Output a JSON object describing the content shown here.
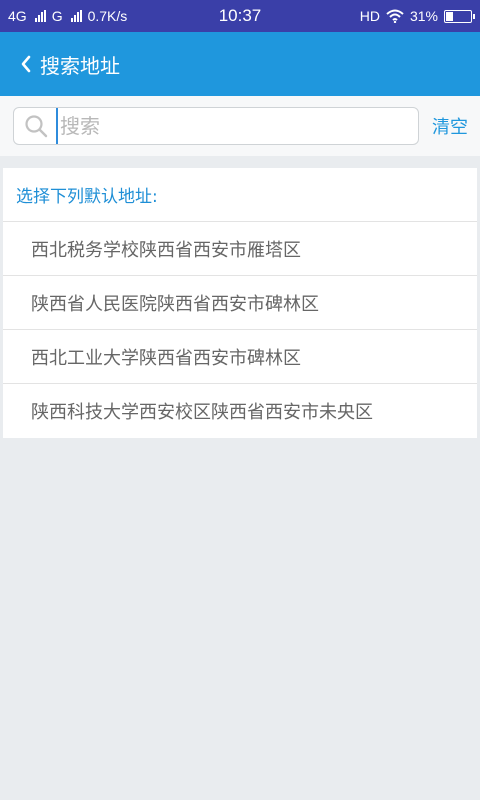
{
  "status_bar": {
    "network1": "4G",
    "network2": "G",
    "speed": "0.7K/s",
    "time": "10:37",
    "hd": "HD",
    "battery": "31%",
    "battery_level": 0.31
  },
  "nav": {
    "title": "搜索地址"
  },
  "search": {
    "placeholder": "搜索",
    "value": "",
    "clear_label": "清空"
  },
  "addresses": {
    "header": "选择下列默认地址:",
    "items": [
      "西北税务学校陕西省西安市雁塔区",
      "陕西省人民医院陕西省西安市碑林区",
      "西北工业大学陕西省西安市碑林区",
      "陕西科技大学西安校区陕西省西安市未央区"
    ]
  },
  "colors": {
    "status_bar": "#3a3fa8",
    "nav_bar": "#1f97dd",
    "accent": "#1f97dd",
    "background": "#e9ecef"
  },
  "icons": {
    "back": "chevron-left-icon",
    "search": "search-icon",
    "wifi": "wifi-icon",
    "signal": "signal-icon",
    "battery": "battery-icon"
  }
}
